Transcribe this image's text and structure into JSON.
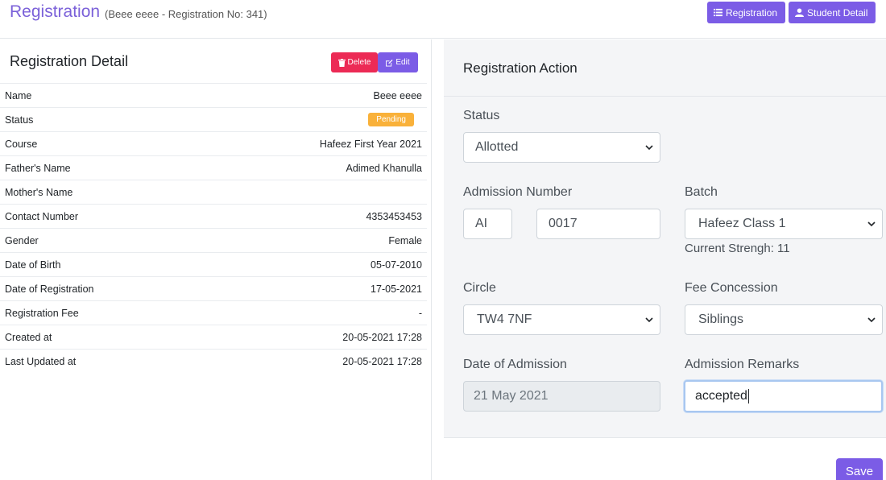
{
  "header": {
    "title": "Registration",
    "subtitle": "(Beee eeee - Registration No: 341)",
    "buttons": {
      "registration": "Registration",
      "student_detail": "Student Detail"
    }
  },
  "detail": {
    "title": "Registration Detail",
    "delete_label": "Delete",
    "edit_label": "Edit",
    "rows": [
      {
        "label": "Name",
        "value": "Beee eeee"
      },
      {
        "label": "Status",
        "value": "Pending"
      },
      {
        "label": "Course",
        "value": "Hafeez First Year 2021"
      },
      {
        "label": "Father's Name",
        "value": "Adimed Khanulla"
      },
      {
        "label": "Mother's Name",
        "value": ""
      },
      {
        "label": "Contact Number",
        "value": "4353453453"
      },
      {
        "label": "Gender",
        "value": "Female"
      },
      {
        "label": "Date of Birth",
        "value": "05-07-2010"
      },
      {
        "label": "Date of Registration",
        "value": "17-05-2021"
      },
      {
        "label": "Registration Fee",
        "value": "-"
      },
      {
        "label": "Created at",
        "value": "20-05-2021 17:28"
      },
      {
        "label": "Last Updated at",
        "value": "20-05-2021 17:28"
      }
    ]
  },
  "action": {
    "title": "Registration Action",
    "status": {
      "label": "Status",
      "value": "Allotted"
    },
    "admission_number": {
      "label": "Admission Number",
      "prefix": "AI",
      "number": "0017"
    },
    "batch": {
      "label": "Batch",
      "value": "Hafeez Class 1",
      "note": "Current Strengh: 11"
    },
    "circle": {
      "label": "Circle",
      "value": "TW4 7NF"
    },
    "fee_concession": {
      "label": "Fee Concession",
      "value": "Siblings"
    },
    "date_of_admission": {
      "label": "Date of Admission",
      "value": "21 May 2021"
    },
    "admission_remarks": {
      "label": "Admission Remarks",
      "value": "accepted"
    },
    "save_label": "Save"
  },
  "colors": {
    "accent": "#7b5ce6",
    "danger": "#ec2a55",
    "warning": "#f9b13a"
  }
}
